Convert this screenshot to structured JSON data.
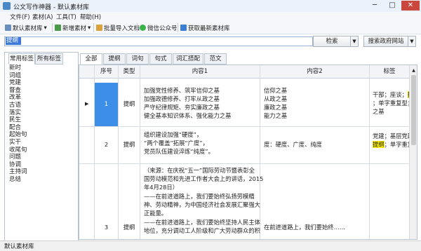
{
  "window": {
    "title": "公文写作神器 - 默认素材库",
    "minimize": "─",
    "maximize": "□",
    "close": "✕"
  },
  "menu": [
    "文件(F)",
    "素材(A)",
    "工具(T)",
    "帮助(H)"
  ],
  "toolbar": {
    "library": "默认素材库",
    "add": "新增素材",
    "import": "批量导入文档",
    "wechat": "微信公众号",
    "fetch": "获取最新素材库",
    "dropdown_arrow": "▾"
  },
  "search": {
    "value": "提纲",
    "button": "检索",
    "gov_button": "搜索政府网站",
    "dropdown_arrow": "▼"
  },
  "left_tabs": [
    "常用标签",
    "所有标签"
  ],
  "tags": [
    "新时",
    "词组",
    "党建",
    "督查",
    "改革",
    "古语",
    "落实",
    "民生",
    "配合",
    "起始句",
    "实干",
    "收尾句",
    "问题",
    "协调",
    "主持词",
    "总结"
  ],
  "right_tabs": [
    "全部",
    "提纲",
    "词句",
    "句式",
    "词汇搭配",
    "范文"
  ],
  "columns": [
    "序号",
    "类型",
    "内容1",
    "内容2",
    "标签"
  ],
  "rows": [
    {
      "index": "1",
      "type": "提纲",
      "content1": [
        "加强党性修养、筑牢信仰之基",
        "加强政德修养、打牢从政之基",
        "严守纪律规矩、夯实廉政之基",
        "健全基本知识体系、强化能力之基"
      ],
      "content2": [
        "信仰之基",
        "从政之基",
        "廉政之基",
        "能力之基"
      ],
      "tags": [
        "干部；座谈；",
        "提纲",
        "；单字重复型；",
        "之基"
      ]
    },
    {
      "index": "2",
      "type": "提纲",
      "content1": [
        "组织建设加强“硬度”，",
        "“两个覆盖”拓展“广度”，",
        "党员队伍建设淬炼“纯度”。"
      ],
      "content2": [
        "度：硬度、广度、纯度"
      ],
      "tags": [
        "党建；基层党建；",
        "提纲",
        "；单字重复型；度"
      ]
    },
    {
      "index": "3",
      "type": "提纲",
      "content1": [
        "（来源：在庆祝“五一”国际劳动节暨表彰全",
        "国劳动模范和先进工作者大会上的讲话，2015",
        "年4月28日）",
        "——在前进道路上，我们要始终弘扬劳模精",
        "神、劳动精神，为中国经济社会发展汇聚强大",
        "正能量。",
        "——在前进道路上，我们要始终坚持人民主体",
        "地位，充分调动工人阶级和广大劳动群众的积"
      ],
      "content2": [
        "在前进道路上，我们要始终……"
      ],
      "tags": []
    }
  ],
  "status": "默认素材库",
  "colors": {
    "selection": "#3c8ee6",
    "highlight": "#fff200",
    "close": "#c9473d"
  }
}
